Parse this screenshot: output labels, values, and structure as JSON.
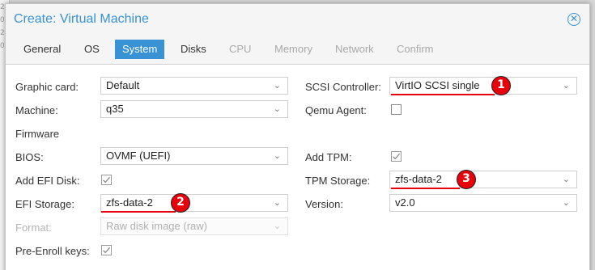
{
  "window": {
    "title": "Create: Virtual Machine"
  },
  "tabs": [
    {
      "label": "General",
      "state": "normal"
    },
    {
      "label": "OS",
      "state": "normal"
    },
    {
      "label": "System",
      "state": "active"
    },
    {
      "label": "Disks",
      "state": "normal"
    },
    {
      "label": "CPU",
      "state": "disabled"
    },
    {
      "label": "Memory",
      "state": "disabled"
    },
    {
      "label": "Network",
      "state": "disabled"
    },
    {
      "label": "Confirm",
      "state": "disabled"
    }
  ],
  "left": {
    "graphic_card": {
      "label": "Graphic card:",
      "value": "Default"
    },
    "machine": {
      "label": "Machine:",
      "value": "q35"
    },
    "firmware_heading": "Firmware",
    "bios": {
      "label": "BIOS:",
      "value": "OVMF (UEFI)"
    },
    "add_efi_disk": {
      "label": "Add EFI Disk:",
      "checked": true
    },
    "efi_storage": {
      "label": "EFI Storage:",
      "value": "zfs-data-2"
    },
    "format": {
      "label": "Format:",
      "value": "Raw disk image (raw)",
      "disabled": true
    },
    "pre_enroll": {
      "label": "Pre-Enroll keys:",
      "checked": true
    }
  },
  "right": {
    "scsi_controller": {
      "label": "SCSI Controller:",
      "value": "VirtIO SCSI single"
    },
    "qemu_agent": {
      "label": "Qemu Agent:",
      "checked": false
    },
    "add_tpm": {
      "label": "Add TPM:",
      "checked": true
    },
    "tpm_storage": {
      "label": "TPM Storage:",
      "value": "zfs-data-2"
    },
    "version": {
      "label": "Version:",
      "value": "v2.0"
    }
  },
  "annotations": {
    "marker1": "1",
    "marker2": "2",
    "marker3": "3"
  },
  "background": {
    "fragments": [
      "2",
      "0",
      "2",
      "0"
    ]
  },
  "colors": {
    "accent": "#3892d4",
    "highlight": "#e8000b"
  }
}
